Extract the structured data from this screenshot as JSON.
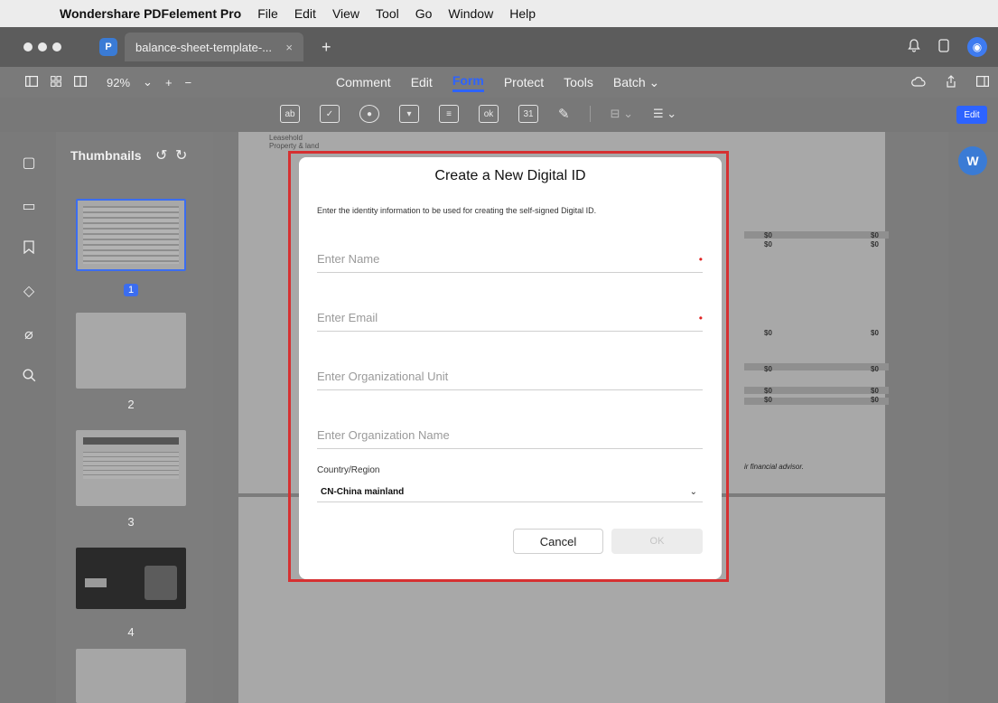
{
  "menubar": {
    "apple_icon": "",
    "app_name": "Wondershare PDFelement Pro",
    "items": [
      "File",
      "Edit",
      "View",
      "Tool",
      "Go",
      "Window",
      "Help"
    ]
  },
  "tabbar": {
    "doc_tab_title": "balance-sheet-template-...",
    "close_glyph": "×",
    "new_tab_glyph": "+",
    "app_icon_letter": "P",
    "avatar_glyph": "◉"
  },
  "toolbar": {
    "zoom": "92%",
    "zoom_in": "+",
    "zoom_out": "−",
    "tabs": [
      "Comment",
      "Edit",
      "Form",
      "Protect",
      "Tools",
      "Batch ⌄"
    ],
    "active_tab": "Form",
    "edit_button": "Edit"
  },
  "thumbnails": {
    "title": "Thumbnails",
    "pages": [
      "1",
      "2",
      "3",
      "4"
    ]
  },
  "background_doc": {
    "lines": [
      "Leasehold",
      "Property & land"
    ],
    "values": [
      "$0",
      "$0",
      "$0",
      "$0",
      "$0",
      "$0",
      "$0",
      "$0",
      "$0",
      "$0",
      "$0",
      "$0"
    ],
    "note_1": "ir financial advisor."
  },
  "dialog": {
    "title": "Create a New Digital ID",
    "description": "Enter the identity information to be used for creating the self-signed Digital ID.",
    "fields": {
      "name_placeholder": "Enter Name",
      "email_placeholder": "Enter Email",
      "org_unit_placeholder": "Enter Organizational Unit",
      "org_name_placeholder": "Enter Organization Name"
    },
    "required_mark": "•",
    "country_label": "Country/Region",
    "country_value": "CN-China mainland",
    "cancel_label": "Cancel",
    "ok_label": "OK"
  },
  "colors": {
    "accent": "#2d63ff",
    "highlight": "#d63031"
  }
}
